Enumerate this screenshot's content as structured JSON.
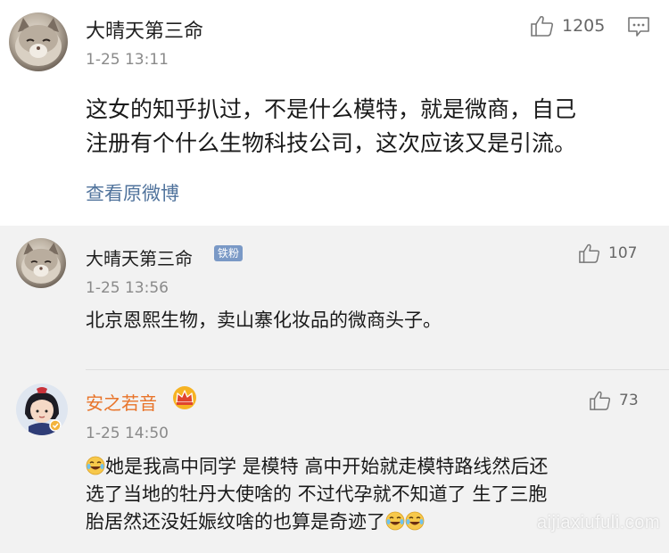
{
  "post": {
    "author": "大晴天第三命",
    "time": "1-25 13:11",
    "likes": "1205",
    "text_line1": "这女的知乎扒过，不是什么模特，就是微商，自己",
    "text_line2": "注册有个什么生物科技公司，这次应该又是引流。",
    "view_original": "查看原微博"
  },
  "replies": [
    {
      "author": "大晴天第三命",
      "badge": "铁粉",
      "time": "1-25 13:56",
      "likes": "107",
      "text": "北京恩熙生物，卖山寨化妆品的微商头子。"
    },
    {
      "author": "安之若音",
      "time": "1-25 14:50",
      "likes": "73",
      "text_line1": "她是我高中同学 是模特 高中开始就走模特路线然后还",
      "text_line2": "选了当地的牡丹大使啥的 不过代孕就不知道了 生了三胞",
      "text_line3": "胎居然还没妊娠纹啥的也算是奇迹了"
    }
  ],
  "watermark": "aijiaxiufuli.com",
  "icons": [
    "thumbs-up-icon",
    "comment-icon",
    "crown-icon",
    "crying-laughing-emoji"
  ],
  "colors": {
    "link": "#50739c",
    "orange_name": "#e8742a",
    "badge": "#7a99c6",
    "reply_bg": "#f2f2f2"
  }
}
